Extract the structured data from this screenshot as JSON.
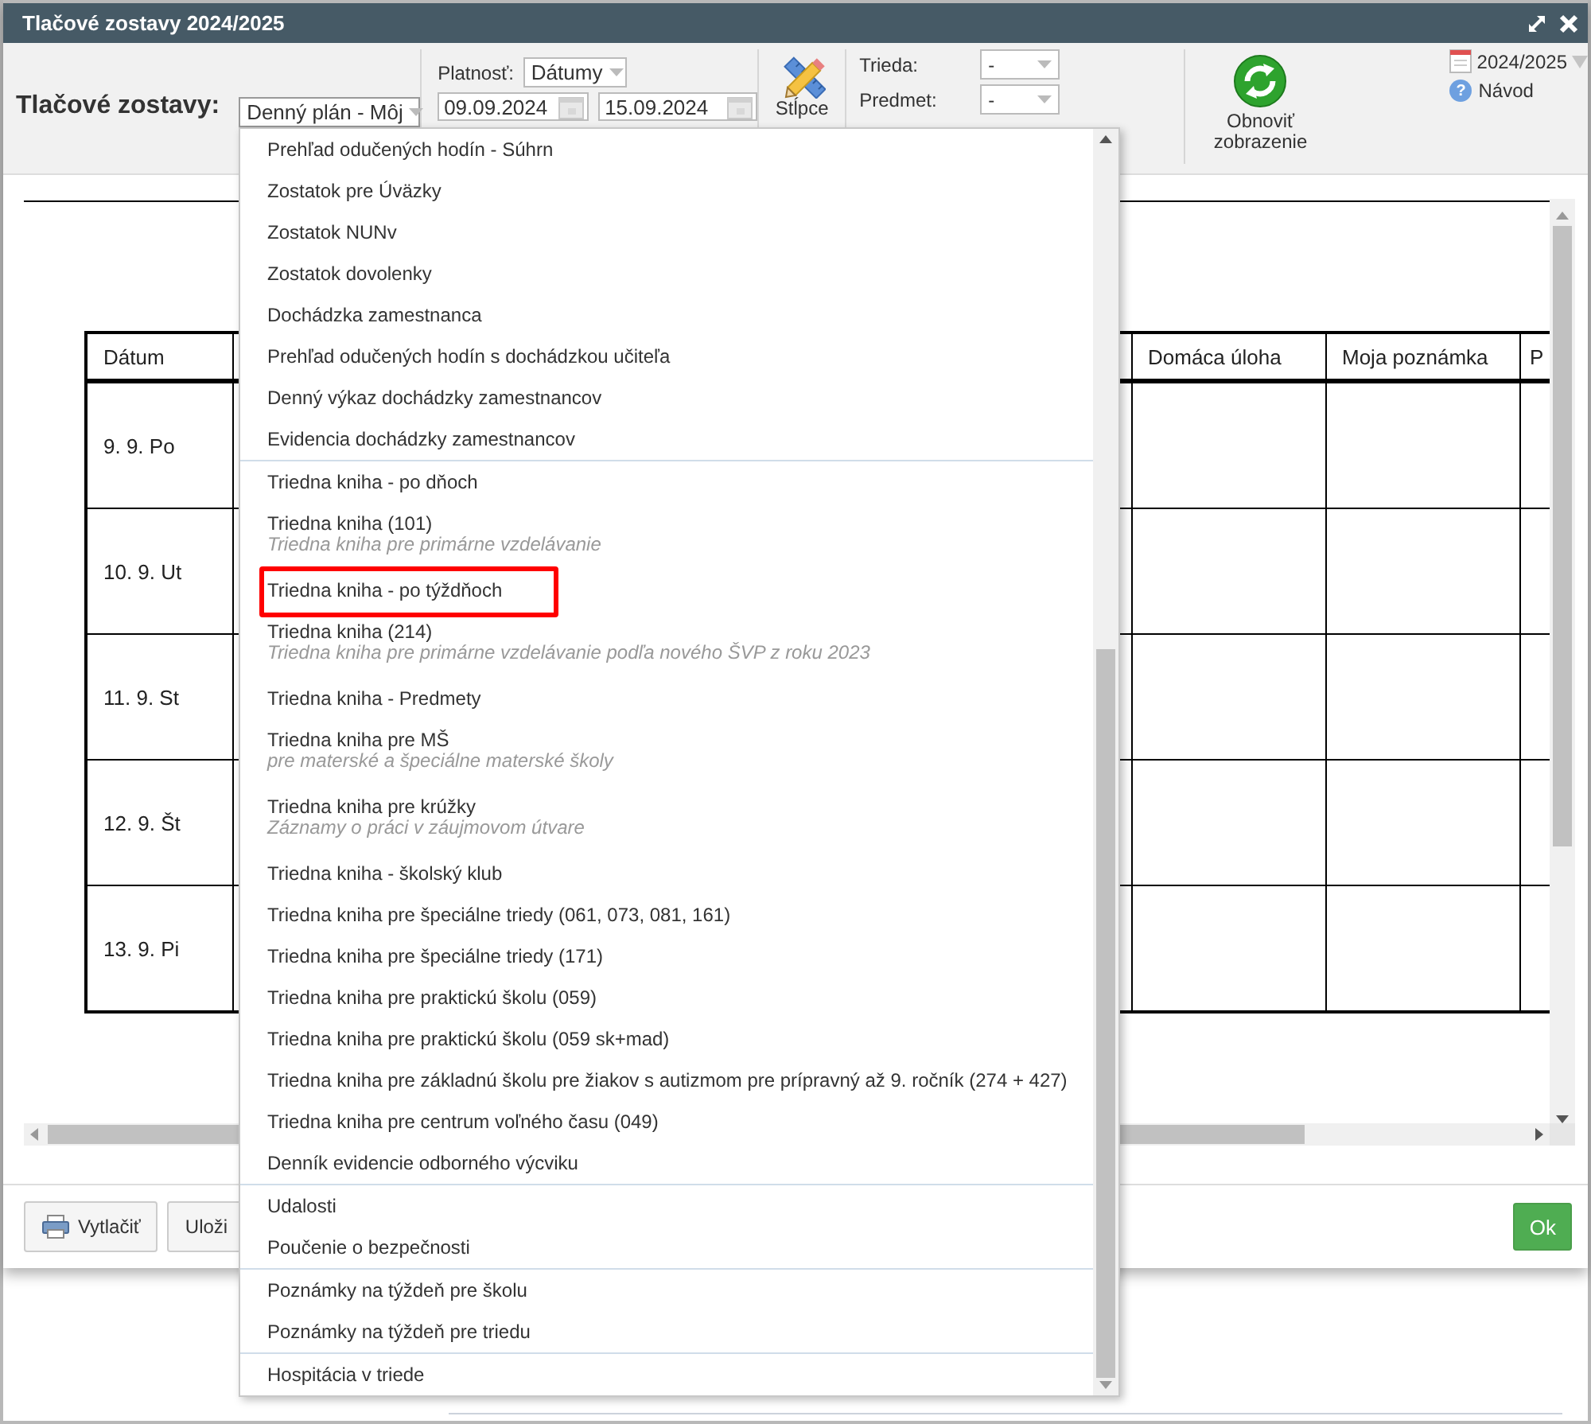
{
  "window": {
    "title": "Tlačové zostavy 2024/2025"
  },
  "toolbar": {
    "report_label": "Tlačové zostavy:",
    "report_select": {
      "value": "Denný plán - Môj",
      "expanded": true
    },
    "validity_label": "Platnosť:",
    "validity_select": {
      "value": "Dátumy"
    },
    "date_from": "09.09.2024",
    "date_to": "15.09.2024",
    "columns_button": "Stĺpce",
    "class_label": "Trieda:",
    "class_select": {
      "value": "-"
    },
    "subject_label": "Predmet:",
    "subject_select": {
      "value": "-"
    },
    "refresh_button": "Obnoviť zobrazenie",
    "school_year": "2024/2025",
    "help_icon": "?",
    "help_link": "Návod"
  },
  "table": {
    "columns": [
      "Dátum",
      "Domáca úloha",
      "Moja poznámka",
      "P"
    ],
    "rows": [
      {
        "date": "9. 9. Po"
      },
      {
        "date": "10. 9. Ut"
      },
      {
        "date": "11. 9. St"
      },
      {
        "date": "12. 9. Št"
      },
      {
        "date": "13. 9. Pi"
      }
    ]
  },
  "footer": {
    "buttons": [
      {
        "label": "Vytlačiť",
        "kind": "print"
      },
      {
        "label": "Uloži",
        "kind": "plain"
      }
    ],
    "ok_button": "Ok"
  },
  "dropdown": {
    "groups": [
      {
        "items": [
          {
            "label": "Prehľad odučených hodín - Súhrn",
            "marked": false
          },
          {
            "label": "Zostatok pre Úväzky",
            "marked": false
          },
          {
            "label": "Zostatok NUNv",
            "marked": false
          },
          {
            "label": "Zostatok dovolenky",
            "marked": false
          },
          {
            "label": "Dochádzka zamestnanca",
            "marked": false
          },
          {
            "label": "Prehľad odučených hodín s dochádzkou učiteľa",
            "marked": false
          },
          {
            "label": "Denný výkaz dochádzky zamestnancov",
            "marked": false
          },
          {
            "label": "Evidencia dochádzky zamestnancov",
            "marked": false
          }
        ]
      },
      {
        "items": [
          {
            "label": "Triedna kniha - po dňoch",
            "marked": false
          },
          {
            "label": "Triedna kniha (101)",
            "subtitle": "Triedna kniha pre primárne vzdelávanie",
            "marked": false
          },
          {
            "label": "Triedna kniha - po týždňoch",
            "marked": true
          },
          {
            "label": "Triedna kniha (214)",
            "subtitle": "Triedna kniha pre primárne vzdelávanie podľa nového ŠVP z roku 2023",
            "marked": false
          },
          {
            "label": "Triedna kniha - Predmety",
            "marked": false
          },
          {
            "label": "Triedna kniha pre MŠ",
            "subtitle": "pre materské a špeciálne materské školy",
            "marked": false
          },
          {
            "label": "Triedna kniha pre krúžky",
            "subtitle": "Záznamy o práci v záujmovom útvare",
            "marked": false
          },
          {
            "label": "Triedna kniha - školský klub",
            "marked": false
          },
          {
            "label": "Triedna kniha pre špeciálne triedy (061, 073, 081, 161)",
            "marked": false
          },
          {
            "label": "Triedna kniha pre špeciálne triedy (171)",
            "marked": false
          },
          {
            "label": "Triedna kniha pre praktickú školu (059)",
            "marked": false
          },
          {
            "label": "Triedna kniha pre praktickú školu (059 sk+mad)",
            "marked": false
          },
          {
            "label": "Triedna kniha pre základnú školu pre žiakov s autizmom pre prípravný až 9. ročník (274 + 427)",
            "marked": false
          },
          {
            "label": "Triedna kniha pre centrum voľného času (049)",
            "marked": false
          },
          {
            "label": "Denník evidencie odborného výcviku",
            "marked": false
          }
        ]
      },
      {
        "items": [
          {
            "label": "Udalosti",
            "marked": false
          },
          {
            "label": "Poučenie o bezpečnosti",
            "marked": false
          }
        ]
      },
      {
        "items": [
          {
            "label": "Poznámky na týždeň pre školu",
            "marked": false
          },
          {
            "label": "Poznámky na týždeň pre triedu",
            "marked": false
          }
        ]
      },
      {
        "items": [
          {
            "label": "Hospitácia v triede",
            "marked": false
          }
        ]
      }
    ]
  }
}
